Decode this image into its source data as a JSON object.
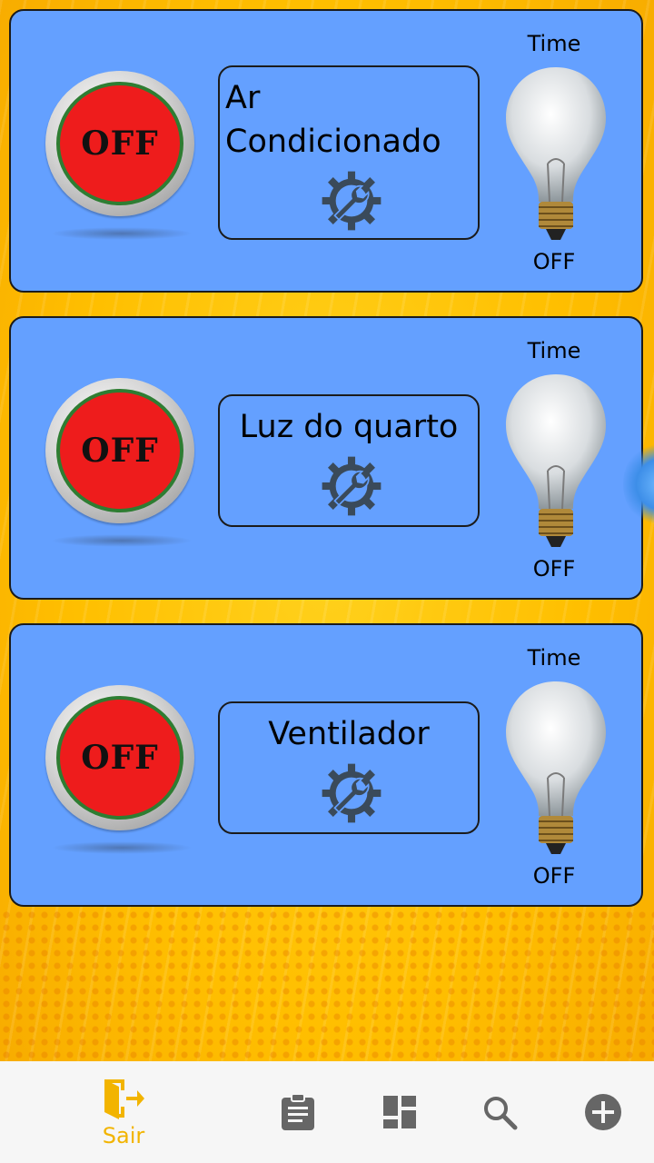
{
  "devices": [
    {
      "name_line1": "Ar",
      "name_line2": "Condicionado",
      "button_label": "OFF",
      "time_label": "Time",
      "status": "OFF"
    },
    {
      "name": "Luz do quarto",
      "button_label": "OFF",
      "time_label": "Time",
      "status": "OFF"
    },
    {
      "name": "Ventilador",
      "button_label": "OFF",
      "time_label": "Time",
      "status": "OFF"
    }
  ],
  "nav": {
    "exit_label": "Sair",
    "items": [
      "exit-icon",
      "clipboard-icon",
      "dashboard-icon",
      "search-icon",
      "add-icon"
    ]
  },
  "colors": {
    "card": "#64a0ff",
    "accent": "#f2b400",
    "off_button": "#ee1c1c",
    "nav_icon": "#666666"
  }
}
